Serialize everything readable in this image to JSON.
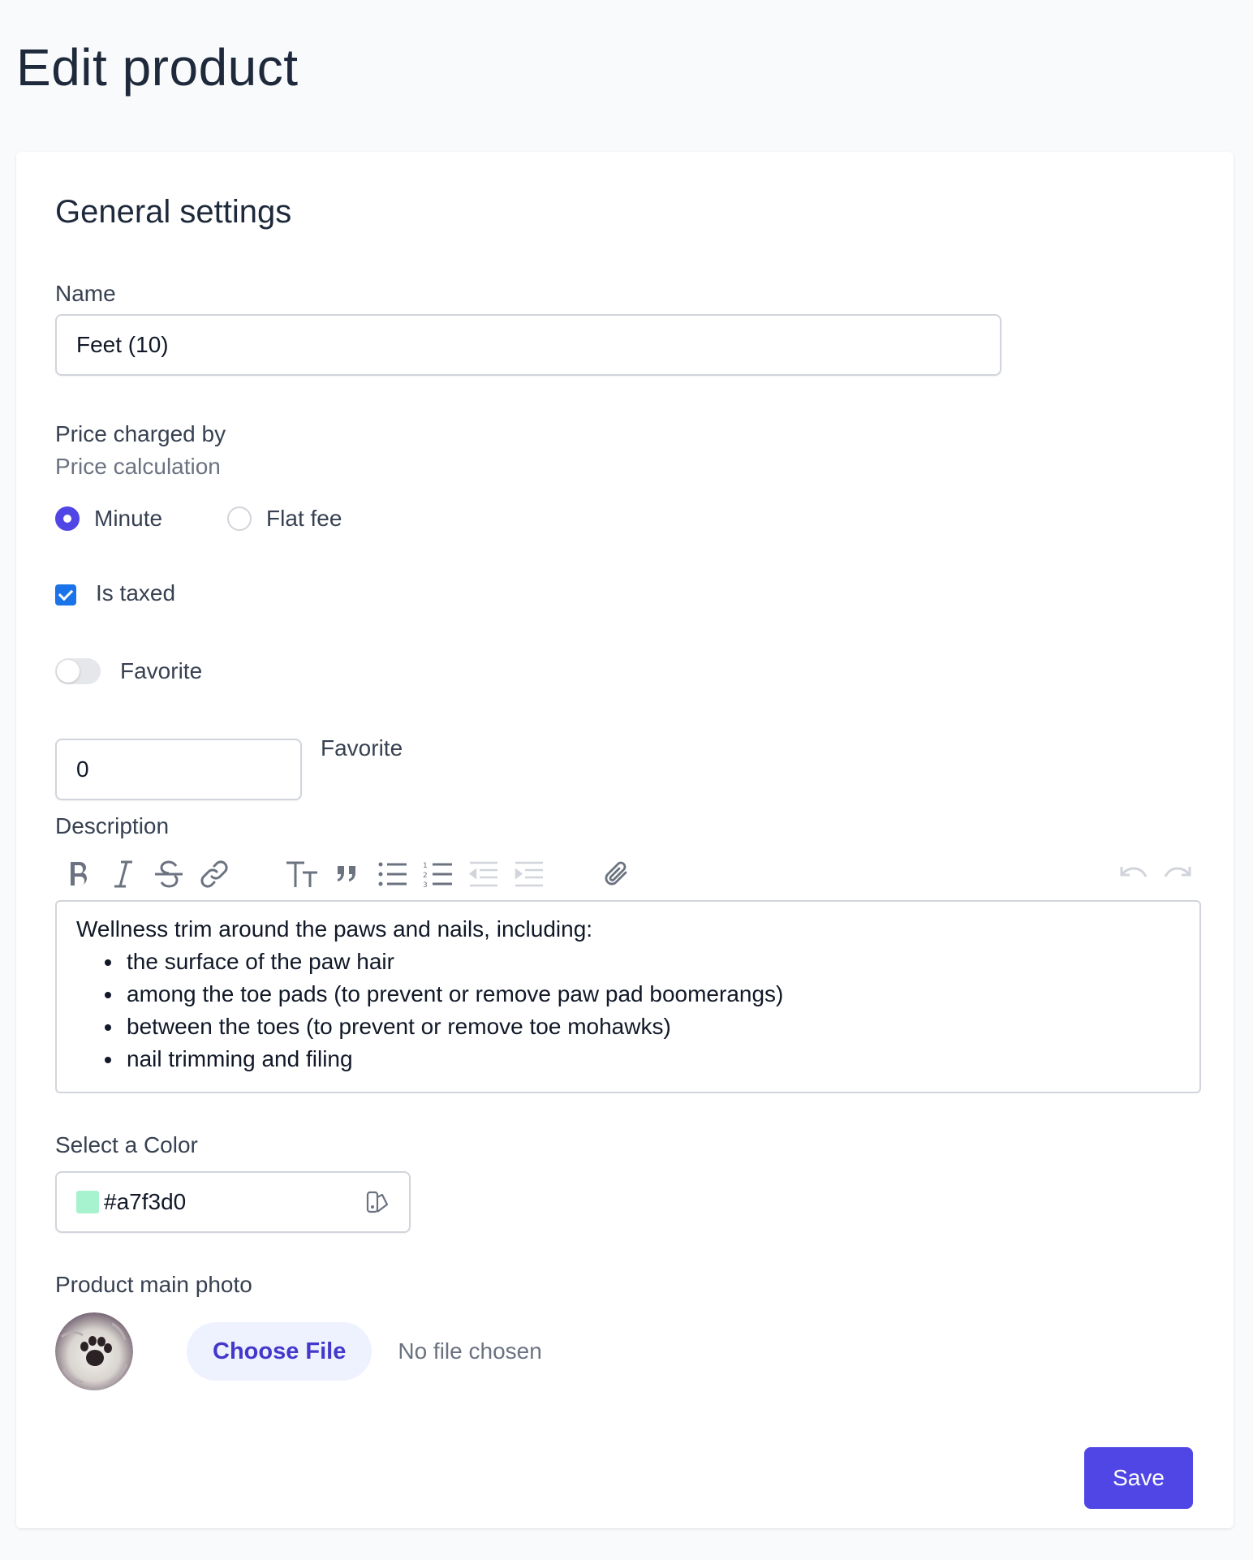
{
  "page": {
    "title": "Edit product"
  },
  "section": {
    "title": "General settings"
  },
  "name_field": {
    "label": "Name",
    "value": "Feet (10)"
  },
  "price": {
    "label": "Price charged by",
    "hint": "Price calculation",
    "options": [
      {
        "label": "Minute",
        "checked": true
      },
      {
        "label": "Flat fee",
        "checked": false
      }
    ]
  },
  "taxed": {
    "label": "Is taxed",
    "checked": true
  },
  "favorite_toggle": {
    "label": "Favorite",
    "on": false
  },
  "favorite_number": {
    "value": "0",
    "label": "Favorite"
  },
  "description": {
    "label": "Description",
    "toolbar": [
      "bold-icon",
      "italic-icon",
      "strikethrough-icon",
      "link-icon",
      "heading-icon",
      "quote-icon",
      "bullet-list-icon",
      "numbered-list-icon",
      "decrease-indent-icon",
      "increase-indent-icon",
      "attach-icon",
      "undo-icon",
      "redo-icon"
    ],
    "intro": "Wellness trim around the paws and nails, including:",
    "items": [
      "the surface of the paw hair",
      "among the toe pads (to prevent or remove paw pad boomerangs)",
      "between the toes (to prevent or remove toe mohawks)",
      "nail trimming and filing"
    ]
  },
  "color": {
    "label": "Select a Color",
    "value": "#a7f3d0",
    "icon": "color-picker-icon"
  },
  "photo": {
    "label": "Product main photo",
    "button": "Choose File",
    "status": "No file chosen"
  },
  "save": {
    "label": "Save"
  },
  "colors": {
    "accent": "#4f46e5",
    "checkbox": "#1a73e8",
    "swatch": "#a7f3d0"
  }
}
